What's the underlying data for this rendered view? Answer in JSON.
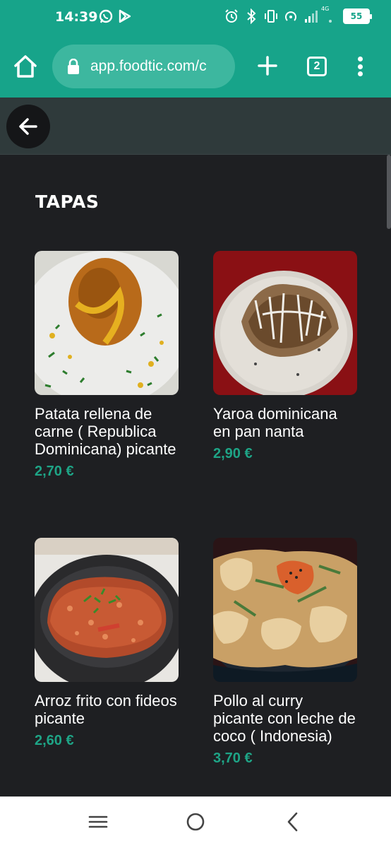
{
  "status_bar": {
    "time": "14:39",
    "network_label": "4G",
    "battery": "55",
    "icons": [
      "whatsapp-icon",
      "play-store-icon",
      "alarm-icon",
      "bluetooth-icon",
      "vibrate-icon",
      "hotspot-icon",
      "signal-icon",
      "wifi-icon"
    ]
  },
  "browser": {
    "url": "app.foodtic.com/c",
    "tab_count": "2",
    "accent_color": "#17a48a"
  },
  "menu": {
    "section_title": "TAPAS",
    "items": [
      {
        "name": "Patata rellena de carne ( Republica Dominicana) picante",
        "price": "2,70 €"
      },
      {
        "name": "Yaroa dominicana en pan nanta",
        "price": "2,90 €"
      },
      {
        "name": "Arroz frito con fideos picante",
        "price": "2,60 €"
      },
      {
        "name": "Pollo al curry picante con leche de coco ( Indonesia)",
        "price": "3,70 €"
      }
    ],
    "price_color": "#1ea486"
  },
  "nav_bar": {
    "icons": [
      "recents-icon",
      "home-circle-icon",
      "back-chevron-icon"
    ]
  }
}
